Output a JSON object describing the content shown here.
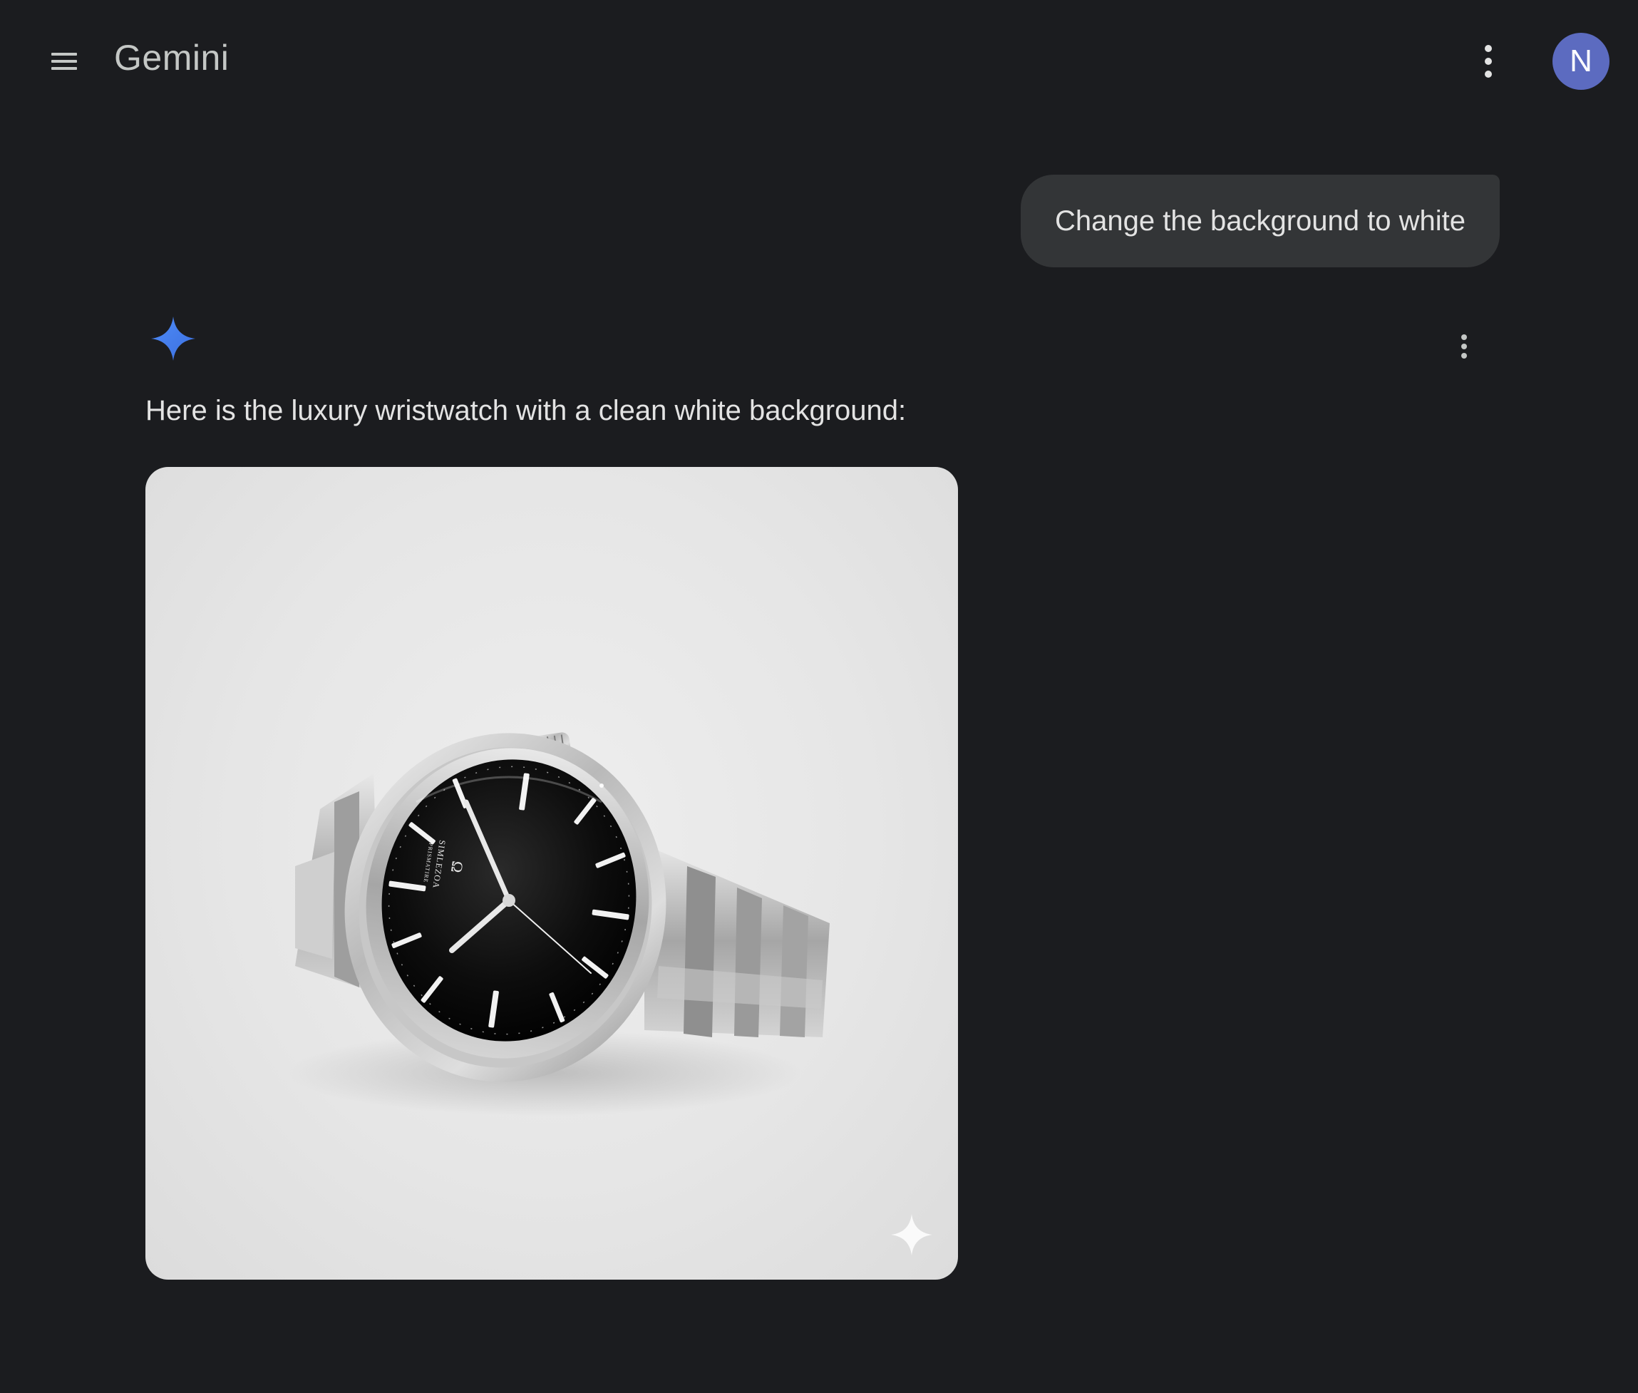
{
  "header": {
    "title": "Gemini",
    "menu_icon": "hamburger-menu-icon",
    "more_icon": "more-vert-icon",
    "avatar_letter": "N",
    "avatar_color": "#5c6bc0"
  },
  "conversation": {
    "user_message": "Change the background to white",
    "response": {
      "icon": "gemini-spark-icon",
      "spark_color": "#4285f4",
      "more_icon": "more-vert-icon",
      "text": "Here is the luxury wristwatch with a clean white background:",
      "image": {
        "subject": "stainless steel wristwatch with black dial on white background",
        "dial_brand": "Ω",
        "dial_text_line1": "SIMLEZOA",
        "dial_text_line2": "PRISMATIRE",
        "watermark_icon": "sparkle-watermark-icon"
      }
    }
  },
  "colors": {
    "background": "#1b1c1f",
    "bubble": "#333537",
    "text": "#e3e3e3"
  }
}
